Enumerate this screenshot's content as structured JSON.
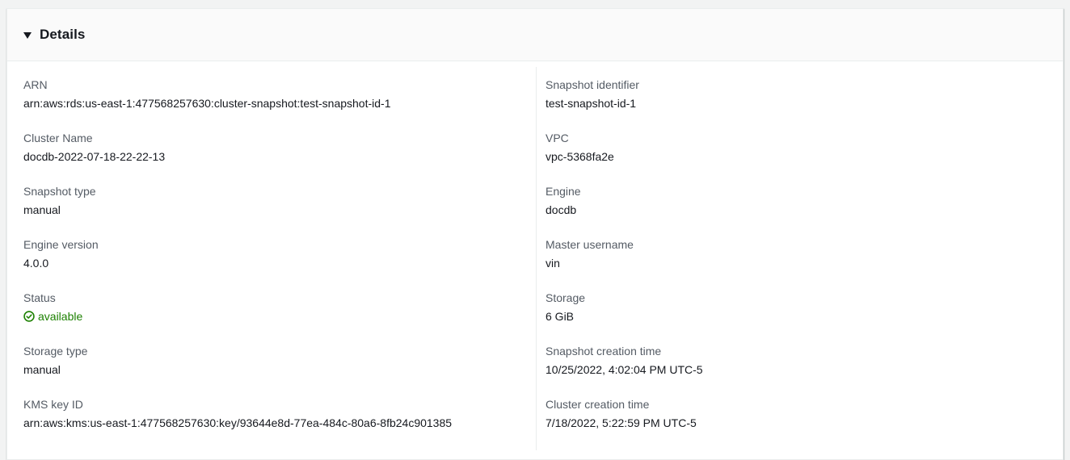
{
  "panel": {
    "title": "Details"
  },
  "left": [
    {
      "label": "ARN",
      "value": "arn:aws:rds:us-east-1:477568257630:cluster-snapshot:test-snapshot-id-1"
    },
    {
      "label": "Cluster Name",
      "value": "docdb-2022-07-18-22-22-13"
    },
    {
      "label": "Snapshot type",
      "value": "manual"
    },
    {
      "label": "Engine version",
      "value": "4.0.0"
    },
    {
      "label": "Status",
      "value": "available"
    },
    {
      "label": "Storage type",
      "value": "manual"
    },
    {
      "label": "KMS key ID",
      "value": "arn:aws:kms:us-east-1:477568257630:key/93644e8d-77ea-484c-80a6-8fb24c901385"
    }
  ],
  "right": [
    {
      "label": "Snapshot identifier",
      "value": "test-snapshot-id-1"
    },
    {
      "label": "VPC",
      "value": "vpc-5368fa2e"
    },
    {
      "label": "Engine",
      "value": "docdb"
    },
    {
      "label": "Master username",
      "value": "vin"
    },
    {
      "label": "Storage",
      "value": "6 GiB"
    },
    {
      "label": "Snapshot creation time",
      "value": "10/25/2022, 4:02:04 PM UTC-5"
    },
    {
      "label": "Cluster creation time",
      "value": "7/18/2022, 5:22:59 PM UTC-5"
    }
  ],
  "icons": {
    "caret": "caret-down-icon",
    "status": "status-success-icon"
  },
  "colors": {
    "status_success": "#1d8102",
    "label": "#545b64",
    "value": "#16191f"
  }
}
